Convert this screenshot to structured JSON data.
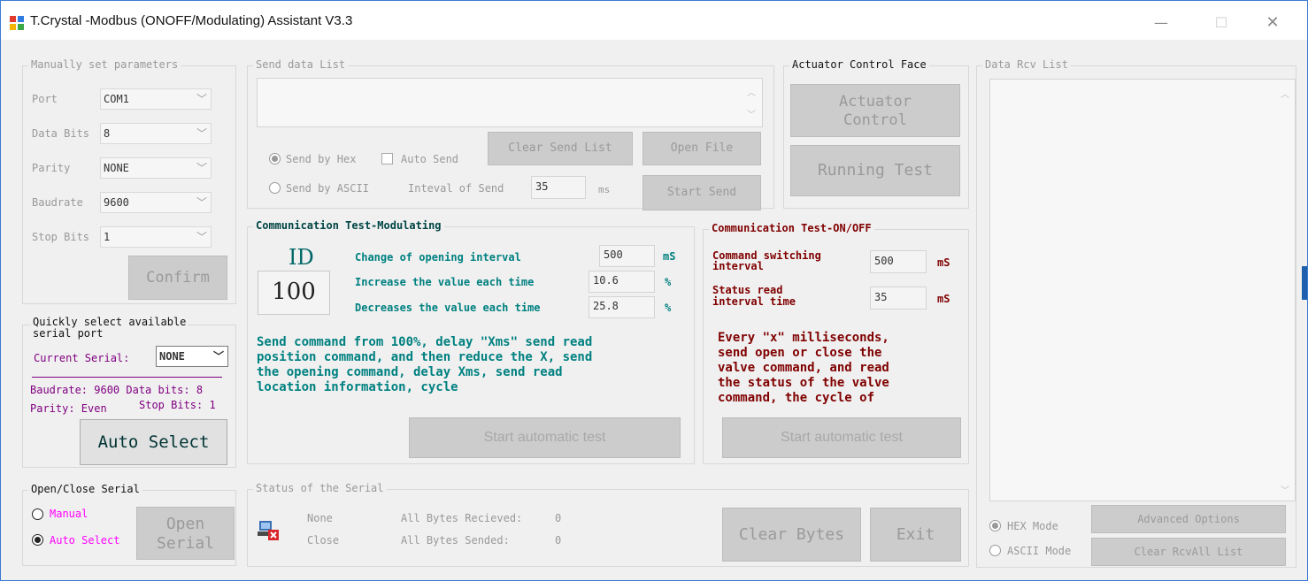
{
  "window": {
    "title": "T.Crystal -Modbus (ONOFF/Modulating) Assistant V3.3",
    "controls": {
      "minimize": "—",
      "maximize": "☐",
      "close": "✕"
    }
  },
  "manual": {
    "title": "Manually set  parameters",
    "port_label": "Port",
    "port_value": "COM1",
    "databits_label": "Data Bits",
    "databits_value": "8",
    "parity_label": "Parity",
    "parity_value": "NONE",
    "baud_label": "Baudrate",
    "baud_value": "9600",
    "stopbits_label": "Stop Bits",
    "stopbits_value": "1",
    "confirm": "Confirm"
  },
  "quick": {
    "title_line1": "Quickly select available",
    "title_line2": "serial port",
    "current_label": "Current Serial:",
    "current_value": "NONE",
    "info_line1": "Baudrate: 9600 Data bits: 8",
    "info_line2a": "Parity: Even",
    "info_line2b": "Stop Bits: 1",
    "auto_select": "Auto Select"
  },
  "openclose": {
    "title": "Open/Close Serial",
    "manual": "Manual",
    "auto": "Auto Select",
    "open_line1": "Open",
    "open_line2": "Serial"
  },
  "send": {
    "title": "Send data List",
    "by_hex": "Send by Hex",
    "auto_send": "Auto Send",
    "by_ascii": "Send by ASCII",
    "interval_label": "Inteval of Send",
    "interval_value": "35",
    "interval_unit": "ms",
    "clear": "Clear Send List",
    "open_file": "Open File",
    "start_send": "Start Send"
  },
  "actuator": {
    "title": "Actuator Control Face",
    "control_line1": "Actuator",
    "control_line2": "Control",
    "running_test": "Running Test"
  },
  "modulating": {
    "title": "Communication Test-Modulating",
    "id_label": "ID",
    "id_value": "100",
    "change_label": "Change of opening interval",
    "change_value": "500",
    "change_unit": "mS",
    "inc_label": "Increase the value each time",
    "inc_value": "10.6",
    "inc_unit": "%",
    "dec_label": "Decreases the value each time",
    "dec_value": "25.8",
    "dec_unit": "%",
    "desc_line1": "Send command from 100%, delay \"Xms\" send read",
    "desc_line2": "position command, and then reduce the X, send",
    "desc_line3": "the opening command, delay Xms, send read",
    "desc_line4": "location information, cycle",
    "start": "Start automatic test"
  },
  "onoff": {
    "title": "Communication Test-ON/OFF",
    "cmd_line1": "Command switching",
    "cmd_line2": "interval",
    "cmd_value": "500",
    "cmd_unit": "mS",
    "status_line1": "Status read",
    "status_line2": "interval time",
    "status_value": "35",
    "status_unit": "mS",
    "desc_line1": "Every \"x\" milliseconds,",
    "desc_line2": "send open or close the",
    "desc_line3": "valve command, and read",
    "desc_line4": "the status of the valve",
    "desc_line5": "command, the cycle of",
    "start": "Start automatic test"
  },
  "status": {
    "title": "Status of the Serial",
    "port_name": "None",
    "port_state": "Close",
    "received_label": "All Bytes Recieved:",
    "received_value": "0",
    "sent_label": "All Bytes Sended:",
    "sent_value": "0",
    "clear_bytes": "Clear Bytes",
    "exit": "Exit"
  },
  "rcv": {
    "title": "Data Rcv List",
    "hex_mode": "HEX Mode",
    "ascii_mode": "ASCII Mode",
    "advanced": "Advanced Options",
    "clear_all": "Clear RcvAll List"
  },
  "colors": {
    "teal": "#008080",
    "maroon": "#800000",
    "magenta": "#ff00ff",
    "purple": "#800080",
    "disabled_button": "#cccccc"
  }
}
